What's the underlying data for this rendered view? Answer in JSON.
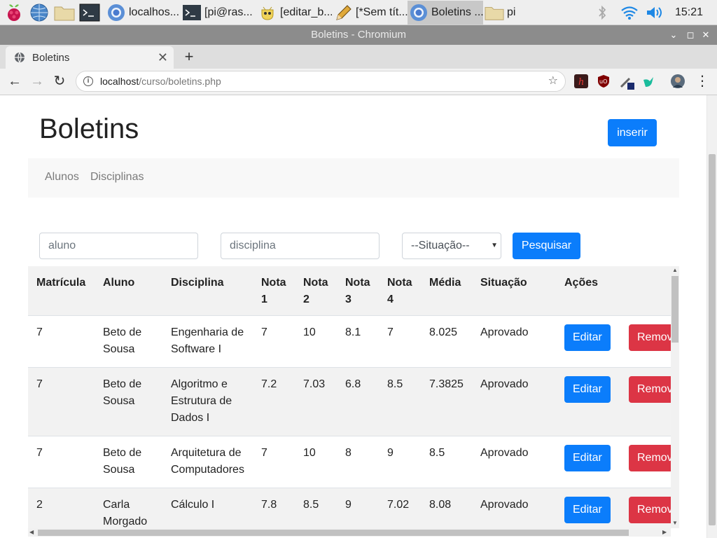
{
  "taskbar": {
    "tasks": [
      {
        "label": "localhos..."
      },
      {
        "label": "[pi@ras..."
      },
      {
        "label": "[editar_b..."
      },
      {
        "label": "[*Sem tít..."
      },
      {
        "label": "Boletins ..."
      },
      {
        "label": "pi"
      }
    ],
    "clock": "15:21"
  },
  "window": {
    "title": "Boletins - Chromium"
  },
  "browser": {
    "tab_title": "Boletins",
    "url_host": "localhost",
    "url_path": "/curso/boletins.php"
  },
  "page": {
    "title": "Boletins",
    "insert_label": "inserir",
    "nav": [
      "Alunos",
      "Disciplinas"
    ],
    "filters": {
      "aluno_placeholder": "aluno",
      "disciplina_placeholder": "disciplina",
      "situacao_selected": "--Situação--",
      "search_label": "Pesquisar"
    },
    "table": {
      "headers": [
        "Matrícula",
        "Aluno",
        "Disciplina",
        "Nota 1",
        "Nota 2",
        "Nota 3",
        "Nota 4",
        "Média",
        "Situação",
        "Ações"
      ],
      "rows": [
        {
          "matricula": "7",
          "aluno": "Beto de Sousa",
          "disciplina": "Engenharia de Software I",
          "n1": "7",
          "n2": "10",
          "n3": "8.1",
          "n4": "7",
          "media": "8.025",
          "situacao": "Aprovado"
        },
        {
          "matricula": "7",
          "aluno": "Beto de Sousa",
          "disciplina": "Algoritmo e Estrutura de Dados I",
          "n1": "7.2",
          "n2": "7.03",
          "n3": "6.8",
          "n4": "8.5",
          "media": "7.3825",
          "situacao": "Aprovado"
        },
        {
          "matricula": "7",
          "aluno": "Beto de Sousa",
          "disciplina": "Arquitetura de Computadores",
          "n1": "7",
          "n2": "10",
          "n3": "8",
          "n4": "9",
          "media": "8.5",
          "situacao": "Aprovado"
        },
        {
          "matricula": "2",
          "aluno": "Carla Morgado",
          "disciplina": "Cálculo I",
          "n1": "7.8",
          "n2": "8.5",
          "n3": "9",
          "n4": "7.02",
          "media": "8.08",
          "situacao": "Aprovado"
        }
      ],
      "edit_label": "Editar",
      "remove_label": "Remover"
    }
  },
  "colors": {
    "primary": "#0b7dfb",
    "danger": "#dc3545",
    "title_bar": "#8c8c8c"
  }
}
